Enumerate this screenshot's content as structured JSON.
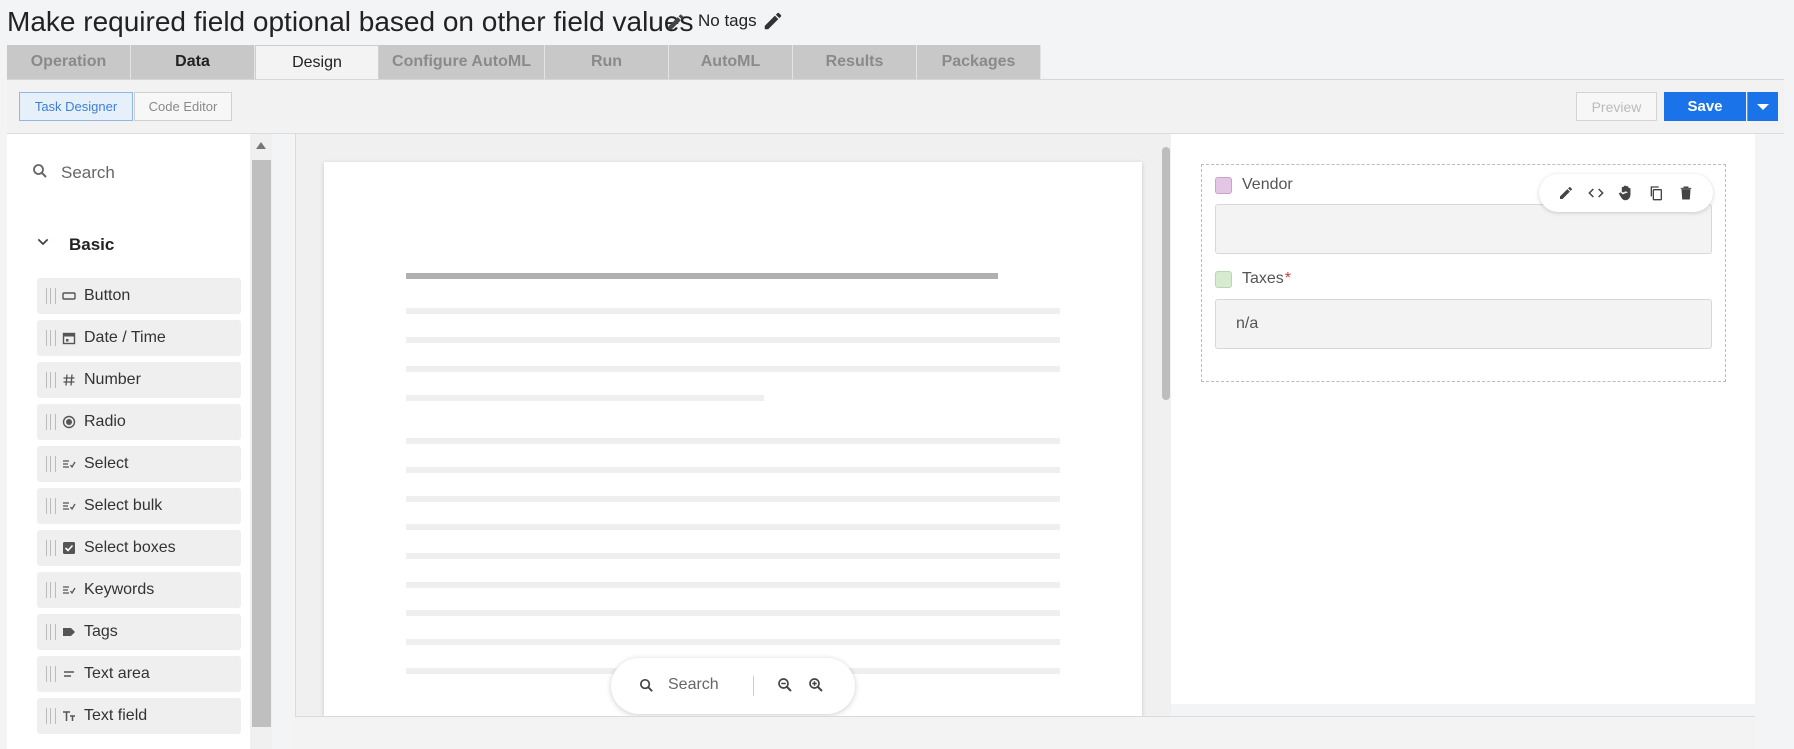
{
  "header": {
    "title": "Make required field optional based on other field values",
    "tags_label": "No tags"
  },
  "tabs": [
    {
      "label": "Operation"
    },
    {
      "label": "Data"
    },
    {
      "label": "Design",
      "active": true
    },
    {
      "label": "Configure AutoML"
    },
    {
      "label": "Run"
    },
    {
      "label": "AutoML"
    },
    {
      "label": "Results"
    },
    {
      "label": "Packages"
    }
  ],
  "toolbar": {
    "task_designer_label": "Task Designer",
    "code_editor_label": "Code Editor",
    "preview_label": "Preview",
    "save_label": "Save"
  },
  "palette": {
    "search_placeholder": "Search",
    "group_label": "Basic",
    "items": [
      {
        "label": "Button",
        "icon": "button-icon"
      },
      {
        "label": "Date / Time",
        "icon": "calendar-icon"
      },
      {
        "label": "Number",
        "icon": "hash-icon"
      },
      {
        "label": "Radio",
        "icon": "radio-icon"
      },
      {
        "label": "Select",
        "icon": "select-list-icon"
      },
      {
        "label": "Select bulk",
        "icon": "select-list-icon"
      },
      {
        "label": "Select boxes",
        "icon": "checkbox-icon"
      },
      {
        "label": "Keywords",
        "icon": "select-list-icon"
      },
      {
        "label": "Tags",
        "icon": "tag-icon"
      },
      {
        "label": "Text area",
        "icon": "text-area-icon"
      },
      {
        "label": "Text field",
        "icon": "text-field-icon"
      }
    ]
  },
  "viewer": {
    "search_label": "Search"
  },
  "form": {
    "fields": [
      {
        "label": "Vendor",
        "required": false,
        "value": "",
        "color": "#e3c6e6"
      },
      {
        "label": "Taxes",
        "required": true,
        "value": "n/a",
        "color": "#d7ebcf"
      }
    ],
    "required_marker": "*"
  },
  "colors": {
    "accent": "#1a73e8",
    "required": "#d9363e"
  }
}
